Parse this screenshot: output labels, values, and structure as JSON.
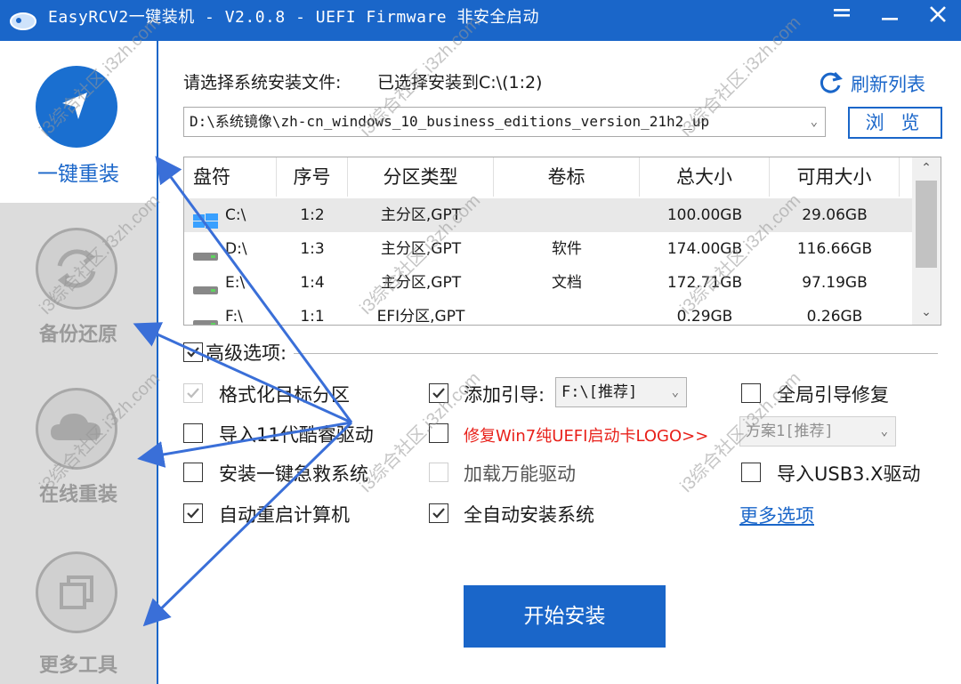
{
  "window": {
    "title": "EasyRCV2一键装机 - V2.0.8 - UEFI Firmware 非安全启动",
    "menu_icon": "menu-icon",
    "minimize_icon": "minimize-icon",
    "close_icon": "close-icon"
  },
  "sidebar": {
    "items": [
      {
        "label": "一键重装",
        "icon": "cursor-arrow-icon",
        "active": true
      },
      {
        "label": "备份还原",
        "icon": "sync-icon",
        "active": false
      },
      {
        "label": "在线重装",
        "icon": "cloud-icon",
        "active": false
      },
      {
        "label": "更多工具",
        "icon": "copy-windows-icon",
        "active": false
      }
    ]
  },
  "main": {
    "prompt": "请选择系统安装文件:",
    "selected_info": "已选择安装到C:\\(1:2)",
    "refresh_label": "刷新列表",
    "path_value": "D:\\系统镜像\\zh-cn_windows_10_business_editions_version_21h2_up",
    "browse_label": "浏 览"
  },
  "table": {
    "headers": [
      "盘符",
      "序号",
      "分区类型",
      "卷标",
      "总大小",
      "可用大小"
    ],
    "rows": [
      {
        "drive": "C:\\",
        "index": "1:2",
        "type": "主分区,GPT",
        "label": "",
        "total": "100.00GB",
        "free": "29.06GB",
        "icon": "windows-drive-icon"
      },
      {
        "drive": "D:\\",
        "index": "1:3",
        "type": "主分区,GPT",
        "label": "软件",
        "total": "174.00GB",
        "free": "116.66GB",
        "icon": "drive-icon"
      },
      {
        "drive": "E:\\",
        "index": "1:4",
        "type": "主分区,GPT",
        "label": "文档",
        "total": "172.71GB",
        "free": "97.19GB",
        "icon": "drive-icon"
      },
      {
        "drive": "F:\\",
        "index": "1:1",
        "type": "EFI分区,GPT",
        "label": "",
        "total": "0.29GB",
        "free": "0.26GB",
        "icon": "drive-icon"
      }
    ]
  },
  "advanced": {
    "title": "高级选项:",
    "options": {
      "format_target": {
        "label": "格式化目标分区",
        "checked": true,
        "disabled": true
      },
      "add_boot": {
        "label": "添加引导:",
        "checked": true
      },
      "boot_dropdown": "F:\\[推荐]",
      "repair_all_boot": {
        "label": "全局引导修复",
        "checked": false
      },
      "import_11gen": {
        "label": "导入11代酷睿驱动",
        "checked": false
      },
      "repair_win7": {
        "label": "修复Win7纯UEFI启动卡LOGO>>",
        "checked": false
      },
      "scheme_dropdown": "方案1[推荐]",
      "install_rescue": {
        "label": "安装一键急救系统",
        "checked": false
      },
      "load_drivers": {
        "label": "加载万能驱动",
        "checked": false,
        "disabled": true
      },
      "import_usb3": {
        "label": "导入USB3.X驱动",
        "checked": false
      },
      "auto_restart": {
        "label": "自动重启计算机",
        "checked": true
      },
      "auto_install": {
        "label": "全自动安装系统",
        "checked": true
      },
      "more_options": "更多选项"
    }
  },
  "start_button": "开始安装",
  "watermark": "i3综合社区.i3zh.com",
  "colors": {
    "accent": "#1a66c9",
    "sidebar_bg": "#dcdcdc",
    "warning_red": "#e8201a"
  }
}
